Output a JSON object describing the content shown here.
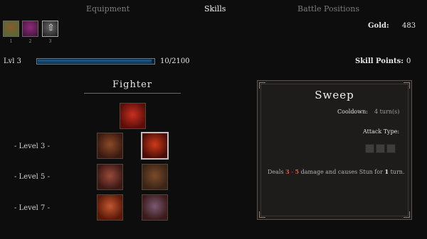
{
  "tabs": {
    "equipment": "Equipment",
    "skills": "Skills",
    "battle_positions": "Battle Positions"
  },
  "party": [
    {
      "name": "party-member-1",
      "number": "1",
      "colors": [
        "#8a5a2c",
        "#4a6b3a"
      ]
    },
    {
      "name": "party-member-2",
      "number": "2",
      "colors": [
        "#8e2a7a",
        "#3a1436"
      ]
    },
    {
      "name": "party-member-3",
      "number": "3",
      "colors": [
        "#6a6a6a",
        "#1b1b1b"
      ]
    }
  ],
  "gold": {
    "label": "Gold:",
    "value": "483"
  },
  "level": {
    "label": "Lvl 3",
    "xp_text": "10/2100",
    "xp_current": 10,
    "xp_max": 2100
  },
  "skill_points": {
    "label": "Skill Points:",
    "value": "0"
  },
  "class_title": "Fighter",
  "row_labels": {
    "level3": "- Level 3 -",
    "level5": "- Level 5 -",
    "level7": "- Level 7 -"
  },
  "skills": {
    "base": {
      "name": "fist-skill-icon",
      "colors": [
        "#c83020",
        "#5a0e0a"
      ]
    },
    "l3a": {
      "name": "armor-skill-icon",
      "colors": [
        "#8a4a28",
        "#3a1a10"
      ]
    },
    "l3b": {
      "name": "sweep-skill-icon",
      "colors": [
        "#d03a18",
        "#4a0e08"
      ]
    },
    "l5a": {
      "name": "rage-skill-icon",
      "colors": [
        "#9a4a3a",
        "#3a1814"
      ]
    },
    "l5b": {
      "name": "barrel-skill-icon",
      "colors": [
        "#7a4a2a",
        "#3a2416"
      ]
    },
    "l7a": {
      "name": "whirlwind-skill-icon",
      "colors": [
        "#c05830",
        "#5a1808"
      ]
    },
    "l7b": {
      "name": "sword-skill-icon",
      "colors": [
        "#7a5a70",
        "#3a1a1a"
      ]
    }
  },
  "detail": {
    "title": "Sweep",
    "cooldown_label": "Cooldown:",
    "cooldown_value": "4 turn(s)",
    "attack_type_label": "Attack Type:",
    "desc_prefix": "Deals",
    "dmg_min": "3",
    "dash": "-",
    "dmg_max": "5",
    "desc_mid": "damage and causes Stun for",
    "duration": "1",
    "desc_suffix": "turn."
  },
  "colors": {
    "damage_highlight": "#e05a3a",
    "xp_bar": "#1f5d8e"
  }
}
